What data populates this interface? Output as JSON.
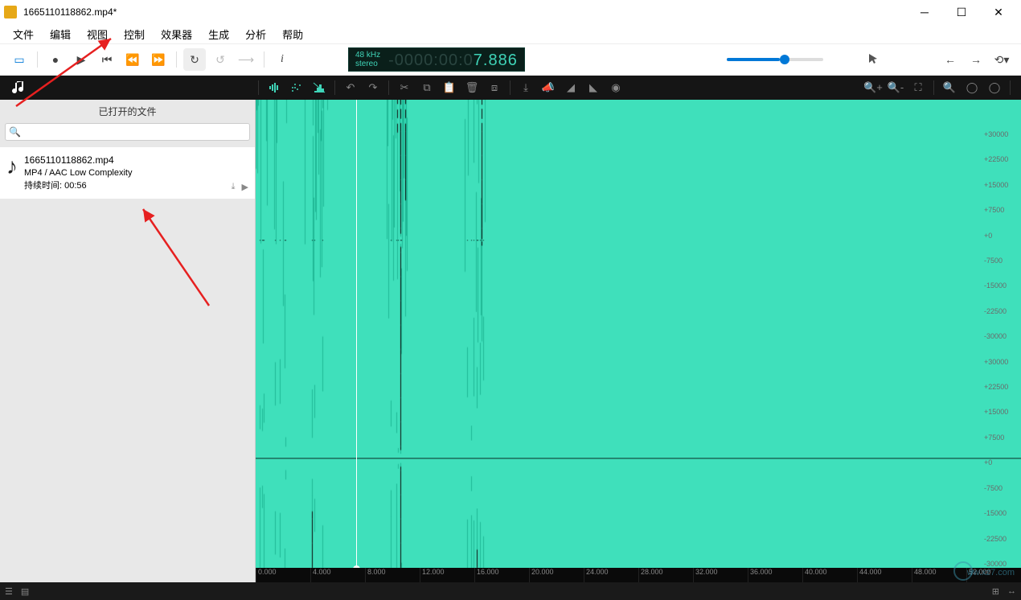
{
  "window": {
    "title": "1665110118862.mp4*"
  },
  "menu": {
    "file": "文件",
    "edit": "编辑",
    "view": "视图",
    "control": "控制",
    "effects": "效果器",
    "generate": "生成",
    "analyze": "分析",
    "help": "帮助"
  },
  "transport": {
    "sample_rate": "48 kHz",
    "channels": "stereo",
    "time_neg": "-0000:00:0",
    "time_pos": "7.886"
  },
  "sidebar": {
    "header": "已打开的文件",
    "search_placeholder": "",
    "file": {
      "name": "1665110118862.mp4",
      "format": "MP4 / AAC Low Complexity",
      "duration_label": "持续时间: 00:56"
    }
  },
  "amplitude_ticks": [
    "+30000",
    "+22500",
    "+15000",
    "+7500",
    "+0",
    "-7500",
    "-15000",
    "-22500",
    "-30000",
    "+30000",
    "+22500",
    "+15000",
    "+7500",
    "+0",
    "-7500",
    "-15000",
    "-22500",
    "-30000"
  ],
  "time_ticks": [
    "0.000",
    "4.000",
    "8.000",
    "12.000",
    "16.000",
    "20.000",
    "24.000",
    "28.000",
    "32.000",
    "36.000",
    "40.000",
    "44.000",
    "48.000",
    "52.000"
  ],
  "watermark": "ww.xz7.com"
}
